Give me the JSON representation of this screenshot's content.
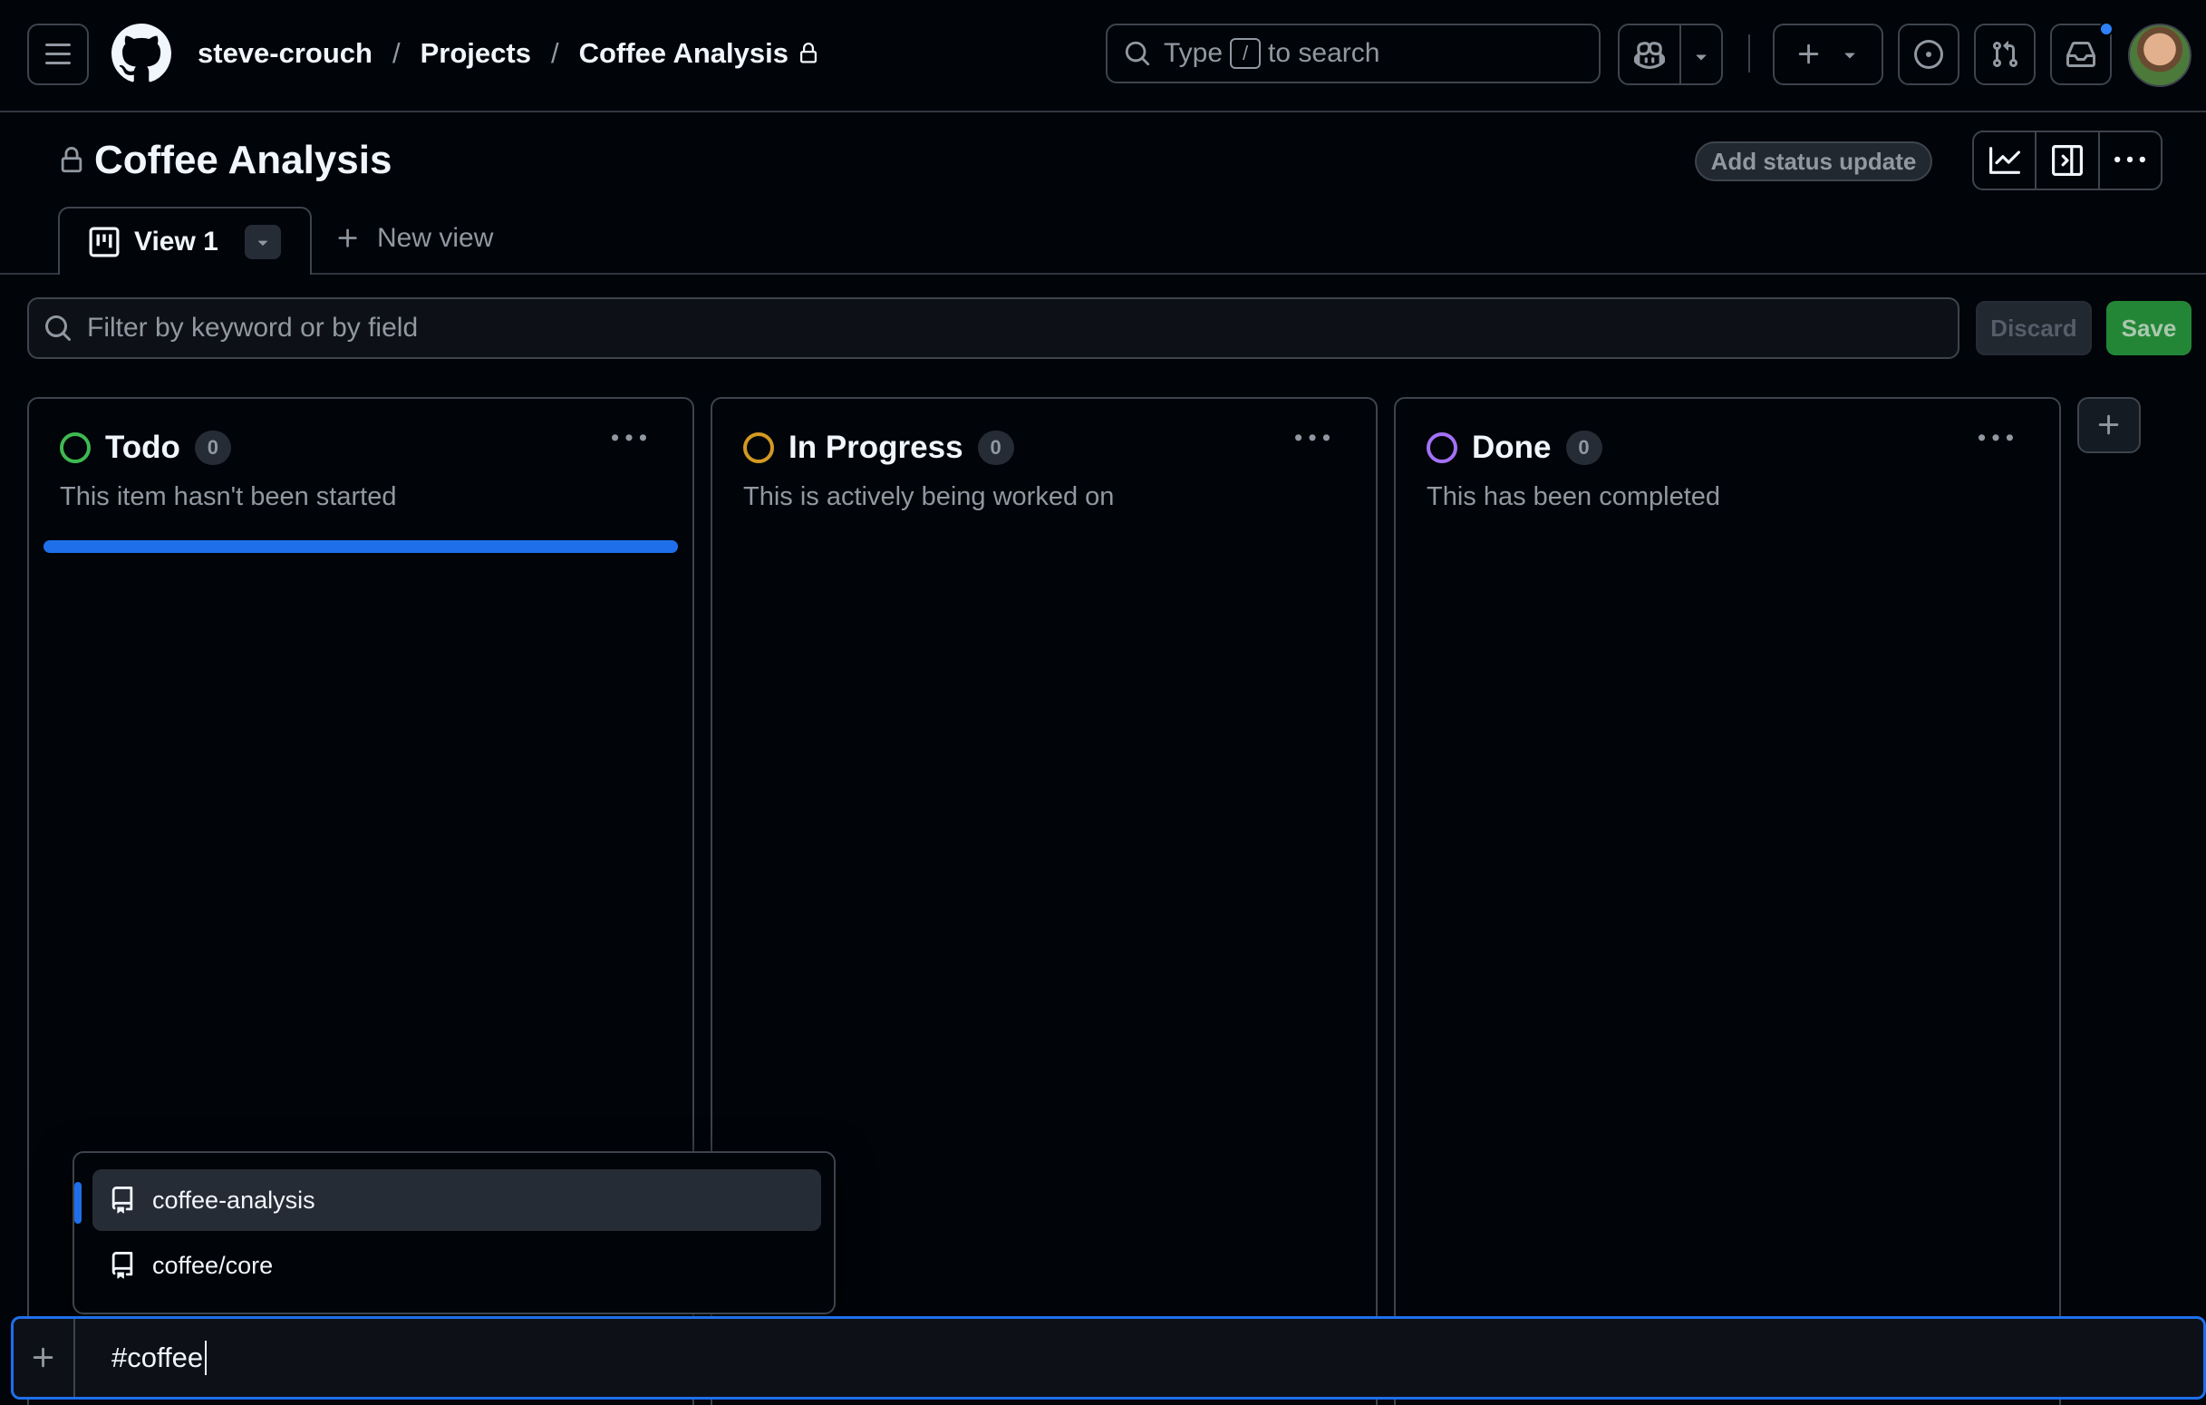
{
  "header": {
    "breadcrumbs": [
      "steve-crouch",
      "Projects",
      "Coffee Analysis"
    ],
    "breadcrumb_sep": "/",
    "search": {
      "before": "Type",
      "key": "/",
      "after": "to search"
    }
  },
  "project": {
    "title": "Coffee Analysis",
    "status_button": "Add status update"
  },
  "tabs": {
    "active": "View 1",
    "new_view": "New view"
  },
  "filter": {
    "placeholder": "Filter by keyword or by field",
    "discard": "Discard",
    "save": "Save"
  },
  "columns": [
    {
      "name": "Todo",
      "count": "0",
      "description": "This item hasn't been started",
      "color": "#3fb950"
    },
    {
      "name": "In Progress",
      "count": "0",
      "description": "This is actively being worked on",
      "color": "#d29922"
    },
    {
      "name": "Done",
      "count": "0",
      "description": "This has been completed",
      "color": "#a371f7"
    }
  ],
  "suggestions": [
    {
      "label": "coffee-analysis"
    },
    {
      "label": "coffee/core"
    }
  ],
  "add_item": {
    "value": "#coffee"
  },
  "colors": {
    "accent": "#1f6feb",
    "save_green": "#238636",
    "notification": "#2f81f7"
  }
}
